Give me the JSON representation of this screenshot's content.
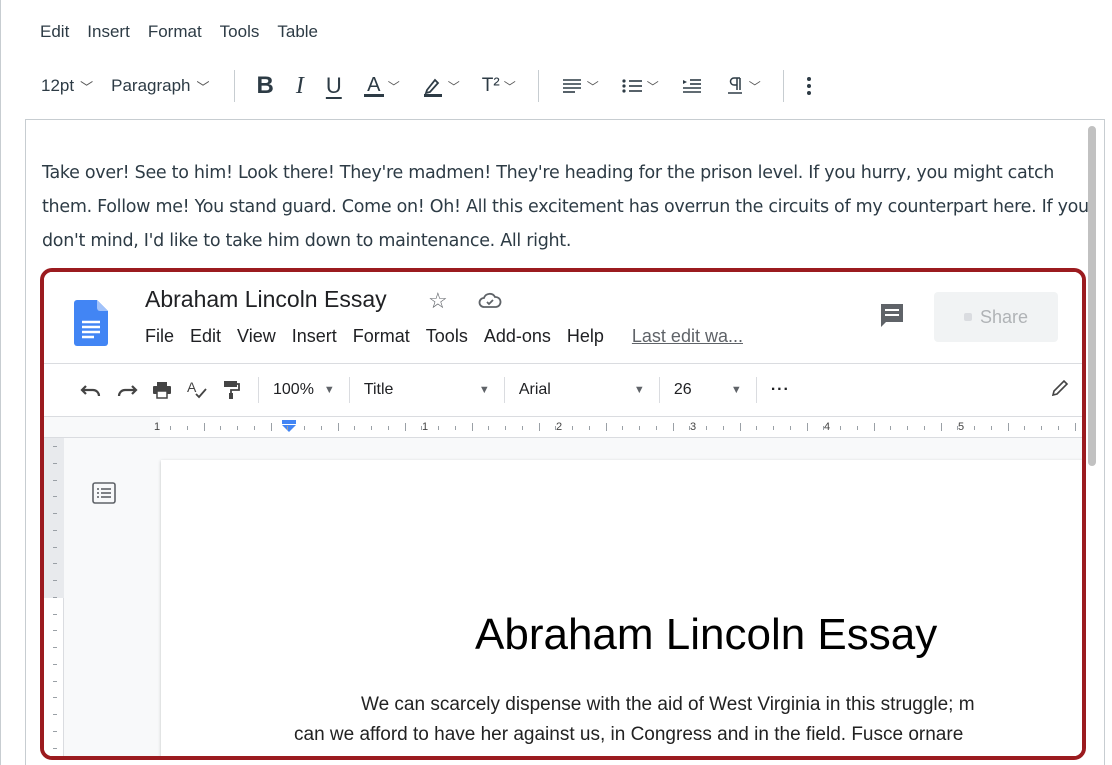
{
  "editor": {
    "menu": [
      "Edit",
      "Insert",
      "Format",
      "Tools",
      "Table"
    ],
    "toolbar": {
      "font_size": "12pt",
      "block_format": "Paragraph",
      "bold": "B",
      "italic": "I",
      "underline": "U",
      "text_color": "A",
      "superscript": "T²"
    },
    "paragraph": "Take over! See to him! Look there! They're madmen! They're heading for the prison level. If you hurry, you might catch them. Follow me! You stand guard. Come on! Oh! All this excitement has overrun the circuits of my counterpart here. If you don't mind, I'd like to take him down to maintenance. All right."
  },
  "gdoc": {
    "title": "Abraham Lincoln Essay",
    "menu": [
      "File",
      "Edit",
      "View",
      "Insert",
      "Format",
      "Tools",
      "Add-ons",
      "Help"
    ],
    "last_edit": "Last edit wa...",
    "share_label": "Share",
    "toolbar": {
      "zoom": "100%",
      "style": "Title",
      "font": "Arial",
      "size": "26",
      "more": "···"
    },
    "ruler_numbers": [
      "1",
      "1",
      "2",
      "3",
      "4",
      "5"
    ],
    "heading": "Abraham Lincoln Essay",
    "body_lines": [
      "We can scarcely dispense with the aid of West Virginia in this struggle; m",
      "can we afford to have her against us, in Congress and in the field. Fusce ornare"
    ]
  },
  "colors": {
    "highlight_border": "#9b1b1f",
    "gdocs_blue": "#4285f4",
    "text": "#2d3b45"
  }
}
